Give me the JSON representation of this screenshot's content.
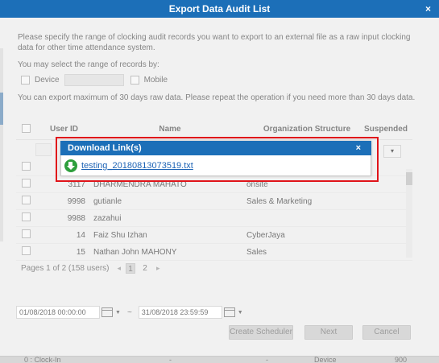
{
  "dialog": {
    "title": "Export Data Audit List",
    "close": "×",
    "intro": "Please specify the range of clocking audit records you want to export to an external file as a raw input clocking data for other time attendance system.",
    "range_prompt": "You may select the range of records by:",
    "device_label": "Device",
    "mobile_label": "Mobile",
    "limit_note": "You can export maximum of 30 days raw data. Please repeat the operation if you need more than 30 days data."
  },
  "table": {
    "headers": [
      "User ID",
      "Name",
      "Organization Structure",
      "Suspended"
    ],
    "filter_select": "▾",
    "rows": [
      {
        "id": "",
        "name": "",
        "org": ""
      },
      {
        "id": "3117",
        "name": "DHARMENDRA MAHATO",
        "org": "onsite"
      },
      {
        "id": "9998",
        "name": "gutianle",
        "org": "Sales & Marketing"
      },
      {
        "id": "9988",
        "name": "zazahui",
        "org": ""
      },
      {
        "id": "14",
        "name": "Faiz Shu Izhan",
        "org": "CyberJaya"
      },
      {
        "id": "15",
        "name": "Nathan John MAHONY",
        "org": "Sales"
      }
    ]
  },
  "pager": {
    "summary": "Pages 1 of 2 (158 users)",
    "prev": "◂",
    "next": "▸",
    "pages": [
      "1",
      "2"
    ]
  },
  "dates": {
    "from": "01/08/2018 00:00:00",
    "to": "31/08/2018 23:59:59",
    "separator": "~"
  },
  "buttons": {
    "create_scheduler": "Create Scheduler",
    "next": "Next",
    "cancel": "Cancel"
  },
  "bottom_strip": {
    "col1": "0 : Clock-In",
    "col2": "-",
    "col3": "-",
    "col4": "Device",
    "col5": "900"
  },
  "popup": {
    "title": "Download Link(s)",
    "close": "×",
    "link": "testing_20180813073519.txt"
  },
  "colors": {
    "title_bar": "#1c6fb8",
    "highlight": "#e0141a",
    "download_icon": "#2e9f3d",
    "link": "#1d63b5"
  }
}
